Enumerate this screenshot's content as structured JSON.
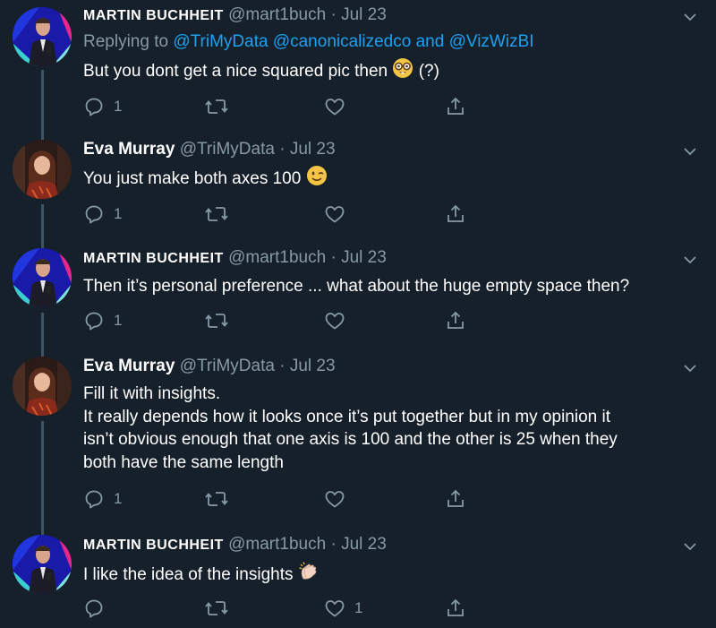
{
  "tweets": [
    {
      "name": "MARTIN BUCHHEIT",
      "handle": "@mart1buch",
      "dot": "·",
      "date": "Jul 23",
      "reply_to": {
        "prefix": "Replying to",
        "mentions": [
          "@TriMyData",
          "@canonicalizedco",
          "@VizWizBI"
        ],
        "and": "and"
      },
      "lines": [
        "But you dont get a nice squared pic then",
        "(?)"
      ],
      "emoji": "nerd-face-emoji",
      "reply_count": "1",
      "retweet_count": "",
      "like_count": ""
    },
    {
      "name": "Eva Murray",
      "handle": "@TriMyData",
      "dot": "·",
      "date": "Jul 23",
      "lines": [
        "You just make both axes 100"
      ],
      "emoji": "winking-face-emoji",
      "reply_count": "1",
      "retweet_count": "",
      "like_count": ""
    },
    {
      "name": "MARTIN BUCHHEIT",
      "handle": "@mart1buch",
      "dot": "·",
      "date": "Jul 23",
      "lines": [
        "Then it’s personal preference ... what about the huge empty space then?"
      ],
      "reply_count": "1",
      "retweet_count": "",
      "like_count": ""
    },
    {
      "name": "Eva Murray",
      "handle": "@TriMyData",
      "dot": "·",
      "date": "Jul 23",
      "lines": [
        "Fill it with insights.",
        "It really depends how it looks once it’s put together but in my opinion it",
        "isn’t obvious enough that one axis is 100 and the other is 25 when they",
        "both have the same length"
      ],
      "reply_count": "1",
      "retweet_count": "",
      "like_count": ""
    },
    {
      "name": "MARTIN BUCHHEIT",
      "handle": "@mart1buch",
      "dot": "·",
      "date": "Jul 23",
      "lines": [
        "I like the idea of the insights"
      ],
      "emoji": "clapping-hands-emoji",
      "reply_count": "",
      "retweet_count": "",
      "like_count": "1"
    }
  ],
  "colors": {
    "background": "#15202b",
    "secondary_text": "#8899a6",
    "link": "#1da1f2",
    "thread_line": "#3d5466"
  }
}
